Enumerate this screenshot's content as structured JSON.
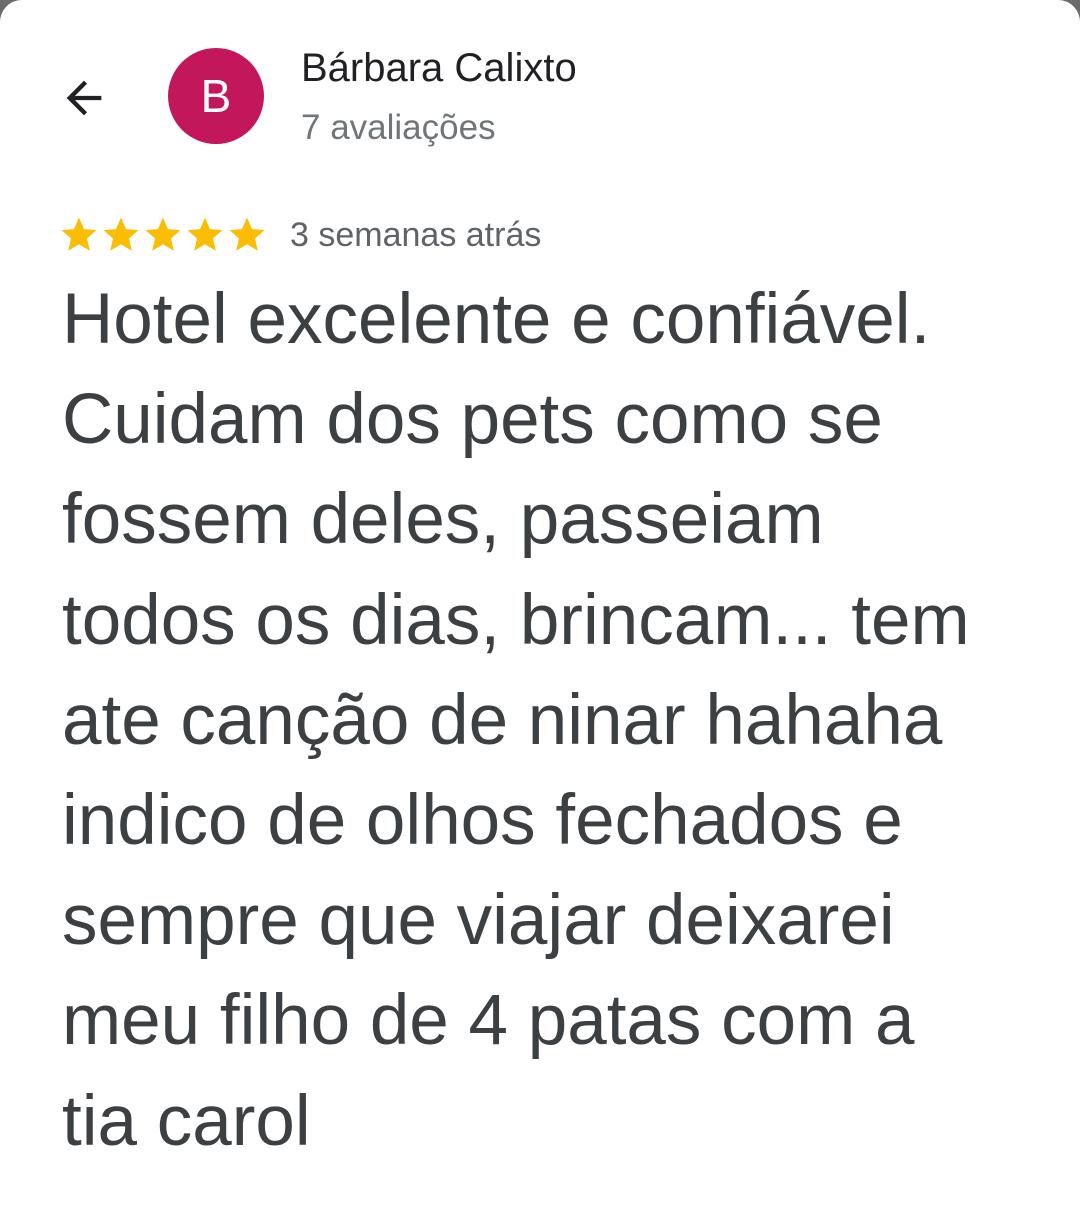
{
  "colors": {
    "avatar_bg": "#c2185b",
    "star": "#fbbc04",
    "text_primary": "#202124",
    "text_secondary": "#70757a",
    "review_text": "#3c4043"
  },
  "header": {
    "back_icon": "arrow-left-icon",
    "avatar_letter": "B",
    "reviewer_name": "Bárbara Calixto",
    "review_count": "7 avaliações"
  },
  "review": {
    "rating": 5,
    "rating_max": 5,
    "date": "3 semanas atrás",
    "text": "Hotel excelente e confiável.\nCuidam dos pets como se\nfossem deles, passeiam\ntodos os dias, brincam... tem\nate canção de ninar hahaha\nindico de olhos fechados e\nsempre que viajar deixarei\nmeu filho de 4 patas com a\ntia carol"
  }
}
